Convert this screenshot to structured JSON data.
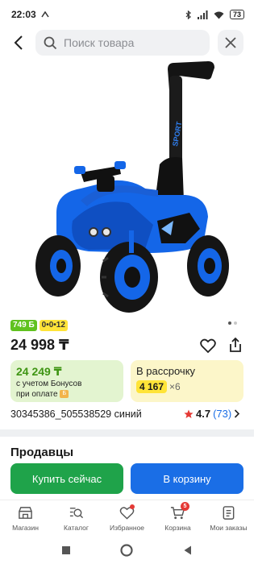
{
  "status_bar": {
    "time": "22:03",
    "battery": "73"
  },
  "search": {
    "placeholder": "Поиск товара"
  },
  "product": {
    "badge_bonus": "749 Б",
    "badge_installment": "0•0•12",
    "price": "24 998 ₸",
    "bonus_price": "24 249 ₸",
    "bonus_text_1": "с учетом Бонусов",
    "bonus_text_2": "при оплате",
    "installment_title": "В рассрочку",
    "installment_amount": "4 167",
    "installment_multiplier": "×6",
    "sku": "30345386_505538529 синий",
    "rating": "4.7",
    "reviews": "(73)",
    "image_text": "SPORT",
    "carousel": {
      "total": 2,
      "active": 0
    }
  },
  "sellers": {
    "title": "Продавцы"
  },
  "actions": {
    "buy_now": "Купить сейчас",
    "add_to_cart": "В корзину"
  },
  "bottom_nav": {
    "items": [
      {
        "label": "Магазин",
        "icon": "store-icon"
      },
      {
        "label": "Каталог",
        "icon": "catalog-search-icon"
      },
      {
        "label": "Избранное",
        "icon": "heart-icon"
      },
      {
        "label": "Корзина",
        "icon": "cart-icon",
        "badge": "5"
      },
      {
        "label": "Мои заказы",
        "icon": "orders-icon"
      }
    ]
  },
  "colors": {
    "green": "#1fa34a",
    "blue": "#1a6ee6",
    "bonus_green": "#3f9514",
    "yellow": "#ffe438"
  }
}
